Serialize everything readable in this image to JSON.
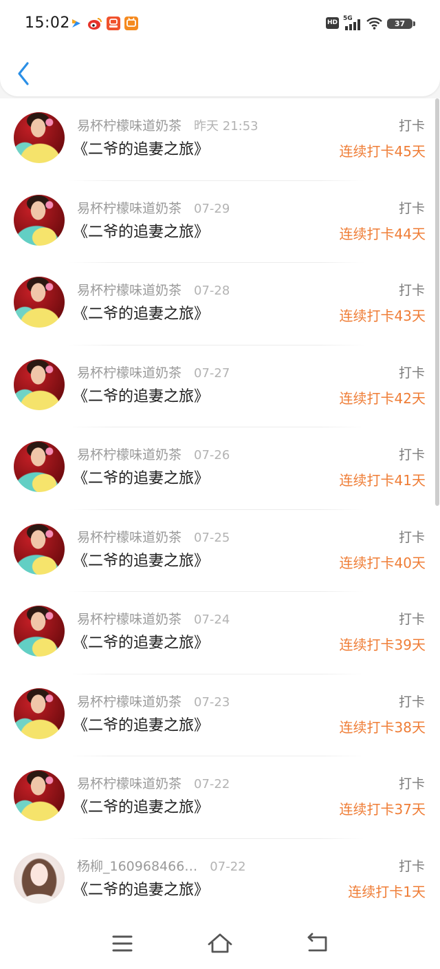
{
  "status_bar": {
    "time": "15:02",
    "hd": "HD",
    "network": "5G",
    "battery": "37",
    "icons": [
      "app-arrow-icon",
      "weibo-icon",
      "app-badge-icon",
      "app-tv-icon",
      "signal-icon",
      "wifi-icon",
      "battery-icon"
    ]
  },
  "header": {
    "back_icon": "back-chevron-icon"
  },
  "items": [
    {
      "name": "易杯柠檬味道奶茶",
      "time": "昨天 21:53",
      "title": "《二爷的追妻之旅》",
      "action": "打卡",
      "streak": "连续打卡45天"
    },
    {
      "name": "易杯柠檬味道奶茶",
      "time": "07-29",
      "title": "《二爷的追妻之旅》",
      "action": "打卡",
      "streak": "连续打卡44天"
    },
    {
      "name": "易杯柠檬味道奶茶",
      "time": "07-28",
      "title": "《二爷的追妻之旅》",
      "action": "打卡",
      "streak": "连续打卡43天"
    },
    {
      "name": "易杯柠檬味道奶茶",
      "time": "07-27",
      "title": "《二爷的追妻之旅》",
      "action": "打卡",
      "streak": "连续打卡42天"
    },
    {
      "name": "易杯柠檬味道奶茶",
      "time": "07-26",
      "title": "《二爷的追妻之旅》",
      "action": "打卡",
      "streak": "连续打卡41天"
    },
    {
      "name": "易杯柠檬味道奶茶",
      "time": "07-25",
      "title": "《二爷的追妻之旅》",
      "action": "打卡",
      "streak": "连续打卡40天"
    },
    {
      "name": "易杯柠檬味道奶茶",
      "time": "07-24",
      "title": "《二爷的追妻之旅》",
      "action": "打卡",
      "streak": "连续打卡39天"
    },
    {
      "name": "易杯柠檬味道奶茶",
      "time": "07-23",
      "title": "《二爷的追妻之旅》",
      "action": "打卡",
      "streak": "连续打卡38天"
    },
    {
      "name": "易杯柠檬味道奶茶",
      "time": "07-22",
      "title": "《二爷的追妻之旅》",
      "action": "打卡",
      "streak": "连续打卡37天"
    },
    {
      "name": "杨柳_160968466…",
      "time": "07-22",
      "title": "《二爷的追妻之旅》",
      "action": "打卡",
      "streak": "连续打卡1天"
    }
  ],
  "nav": {
    "icons": [
      "menu-icon",
      "home-icon",
      "return-icon"
    ]
  },
  "colors": {
    "accent": "#ef7d36",
    "back_button": "#2a8fe6",
    "name_text": "#9a9a9a",
    "title_text": "#1e1e1e"
  }
}
